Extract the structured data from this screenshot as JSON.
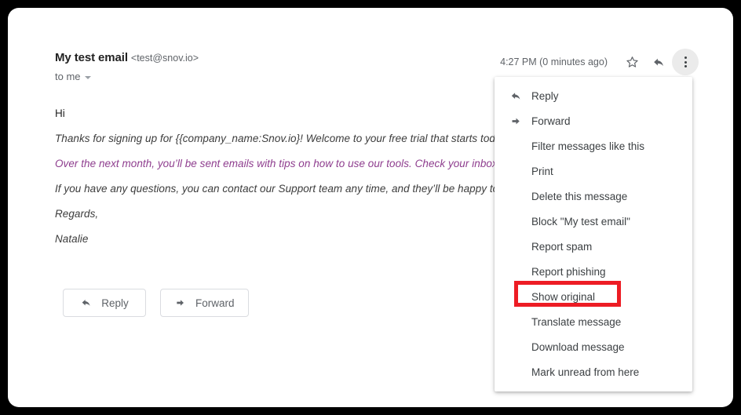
{
  "message": {
    "sender_name": "My test email",
    "sender_email": "<test@snov.io>",
    "recipient": "to me",
    "timestamp": "4:27 PM (0 minutes ago)",
    "star_icon": "star-outline-icon",
    "reply_icon": "reply-arrow-icon",
    "more_icon": "more-vertical-icon"
  },
  "body": {
    "lines": [
      {
        "text": "Hi",
        "style": "plain"
      },
      {
        "text": "Thanks for signing up for {{company_name:Snov.io}! Welcome to your free trial that starts today",
        "style": "italic"
      },
      {
        "text": "Over the next month, you’ll be sent emails with tips on how to use our tools. Check your inbox fo",
        "style": "accent"
      },
      {
        "text": "If you have any questions, you can contact our Support team any time, and they’ll be happy to a",
        "style": "italic"
      },
      {
        "text": "Regards,",
        "style": "italic"
      },
      {
        "text": "Natalie",
        "style": "italic"
      }
    ]
  },
  "actions": [
    {
      "label": "Reply",
      "icon": "reply-arrow-icon"
    },
    {
      "label": "Forward",
      "icon": "forward-arrow-icon"
    }
  ],
  "menu": {
    "items": [
      {
        "label": "Reply",
        "icon": "reply-arrow-icon"
      },
      {
        "label": "Forward",
        "icon": "forward-arrow-icon"
      },
      {
        "label": "Filter messages like this",
        "icon": ""
      },
      {
        "label": "Print",
        "icon": ""
      },
      {
        "label": "Delete this message",
        "icon": ""
      },
      {
        "label": "Block \"My test email\"",
        "icon": ""
      },
      {
        "label": "Report spam",
        "icon": ""
      },
      {
        "label": "Report phishing",
        "icon": ""
      },
      {
        "label": "Show original",
        "icon": ""
      },
      {
        "label": "Translate message",
        "icon": ""
      },
      {
        "label": "Download message",
        "icon": ""
      },
      {
        "label": "Mark unread from here",
        "icon": ""
      }
    ],
    "highlighted_item": "Show original"
  },
  "colors": {
    "annotation_red": "#ed1c24",
    "accent_purple": "#8e3d8e",
    "text_primary": "#3c4043",
    "text_secondary": "#5f6368"
  }
}
